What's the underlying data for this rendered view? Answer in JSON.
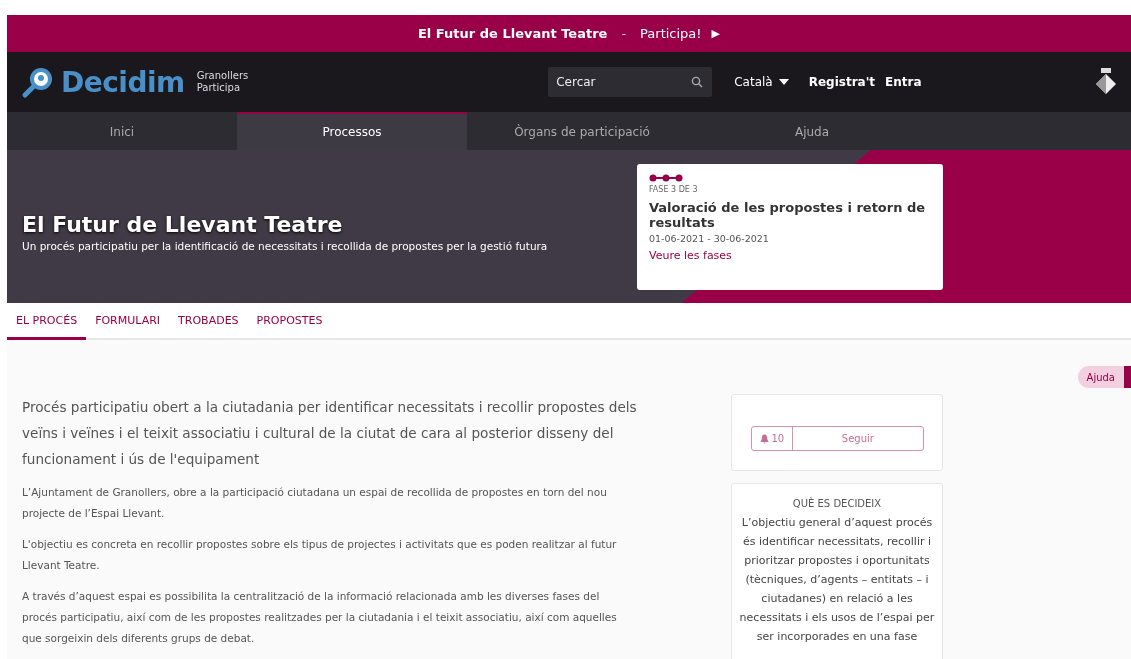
{
  "announcement": {
    "title": "El Futur de Llevant Teatre",
    "separator": "-",
    "link": "Participa!",
    "arrow": "▶"
  },
  "header": {
    "logo_text": "Decidim",
    "org_lines": [
      "Granollers",
      "Participa"
    ],
    "search": {
      "placeholder": "Cercar"
    },
    "language": "Català",
    "links": [
      "Registra't",
      "Entra"
    ]
  },
  "main_nav": [
    {
      "label": "Inici",
      "selected": false
    },
    {
      "label": "Processos",
      "selected": true
    },
    {
      "label": "Òrgans de participació",
      "selected": false
    },
    {
      "label": "Ajuda",
      "selected": false
    }
  ],
  "hero": {
    "title": "El Futur de Llevant Teatre",
    "subtitle": "Un procés participatiu per la identificació de necessitats i recollida de propostes per la gestió futura",
    "phase_card": {
      "phase_count": "FASE 3 DE 3",
      "title": "Valoració de les propostes i retorn de resultats",
      "dates": "01-06-2021 - 30-06-2021",
      "link": "Veure les fases"
    }
  },
  "tabs": [
    {
      "label": "EL PROCÉS",
      "selected": true
    },
    {
      "label": "FORMULARI",
      "selected": false
    },
    {
      "label": "TROBADES",
      "selected": false
    },
    {
      "label": "PROPOSTES",
      "selected": false
    }
  ],
  "help_button": "Ajuda",
  "intro": "Procés participatiu obert a la ciutadania per identificar necessitats i recollir propostes dels veïns i veïnes i el teixit associatiu i cultural de la ciutat de cara al posterior disseny del funcionament i ús de l'equipament",
  "paragraphs": [
    "L’Ajuntament de Granollers, obre a la participació ciutadana un espai de recollida de propostes en torn del nou projecte de l’Espai Llevant.",
    "L'objectiu es concreta en recollir propostes sobre els tipus de projectes i activitats que es poden realitzar al futur Llevant Teatre.",
    "A través d’aquest espai es possibilita la centralització de la informació relacionada amb les diverses fases del procés participatiu, així com de les propostes realitzades per la ciutadania i el teixit associatiu, així com aquelles que sorgeixin dels diferents grups de debat."
  ],
  "follow": {
    "count": "10",
    "label": "Seguir"
  },
  "what_is_decided": {
    "heading": "QUÈ ES DECIDEIX",
    "text": "L’objectiu general d’aquest procés és identificar necessitats, recollir i prioritzar propostes i oportunitats (tècniques, d’agents – entitats – i ciutadanes) en relació a les necessitats i els usos de l’espai per ser incorporades en una fase"
  }
}
